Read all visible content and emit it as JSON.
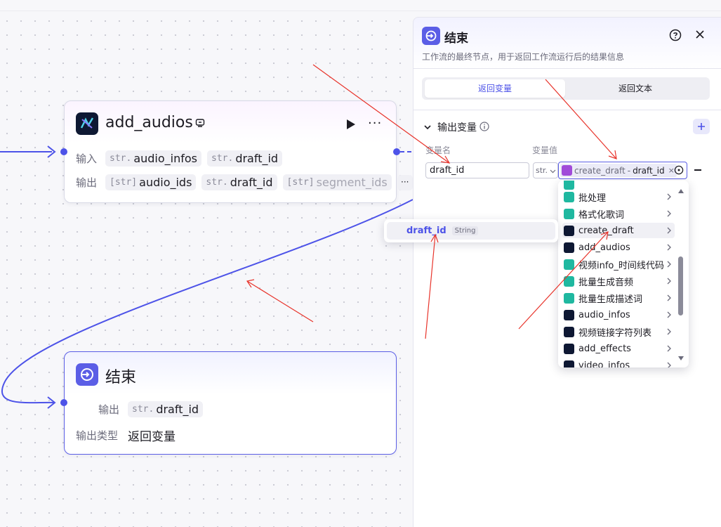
{
  "canvas": {
    "node_add_audios": {
      "title": "add_audios",
      "icon": "jianying-app-icon",
      "input_label": "输入",
      "output_label": "输出",
      "inputs": [
        {
          "type": "str.",
          "name": "audio_infos"
        },
        {
          "type": "str.",
          "name": "draft_id"
        }
      ],
      "outputs": [
        {
          "type": "[str]",
          "name": "audio_ids"
        },
        {
          "type": "str.",
          "name": "draft_id"
        },
        {
          "type": "[str]",
          "name": "segment_ids"
        }
      ],
      "more_label": "···"
    },
    "node_end": {
      "title": "结束",
      "output_label": "输出",
      "output_tag": {
        "type": "str.",
        "name": "draft_id"
      },
      "output_type_label": "输出类型",
      "output_type_value": "返回变量"
    }
  },
  "panel": {
    "title": "结束",
    "description": "工作流的最终节点，用于返回工作流运行后的结果信息",
    "tabs": [
      "返回变量",
      "返回文本"
    ],
    "active_tab": 0,
    "section_title": "输出变量",
    "col_name_header": "变量名",
    "col_value_header": "变量值",
    "var_name_value": "draft_id",
    "var_type": "str.",
    "var_value_node": "create_draft",
    "var_value_sep": "-",
    "var_value_field": "draft_id",
    "var_value_clear": "×"
  },
  "dropdown": {
    "partial_top_item": "",
    "items": [
      {
        "label": "批处理",
        "icon": "batch-icon",
        "color": "#1fb8a0"
      },
      {
        "label": "格式化歌词",
        "icon": "code-icon",
        "color": "#1fb8a0"
      },
      {
        "label": "create_draft",
        "icon": "jianying-app-icon",
        "color": "#0e1833"
      },
      {
        "label": "add_audios",
        "icon": "jianying-app-icon",
        "color": "#0e1833"
      },
      {
        "label": "视频info_时间线代码",
        "icon": "code-icon",
        "color": "#1fb8a0"
      },
      {
        "label": "批量生成音频",
        "icon": "loop-icon",
        "color": "#1fb8a0"
      },
      {
        "label": "批量生成描述词",
        "icon": "loop-icon",
        "color": "#1fb8a0"
      },
      {
        "label": "audio_infos",
        "icon": "jianying-app-icon",
        "color": "#0e1833"
      },
      {
        "label": "视频链接字符列表",
        "icon": "jianying-app-icon",
        "color": "#0e1833"
      },
      {
        "label": "add_effects",
        "icon": "jianying-app-icon",
        "color": "#0e1833"
      },
      {
        "label": "video_infos",
        "icon": "jianying-app-icon",
        "color": "#0e1833"
      }
    ],
    "hovered_index": 2
  },
  "submenu": {
    "name": "draft_id",
    "type": "String"
  },
  "colors": {
    "accent": "#4d53e8",
    "annotation_arrow": "#e8332a"
  }
}
